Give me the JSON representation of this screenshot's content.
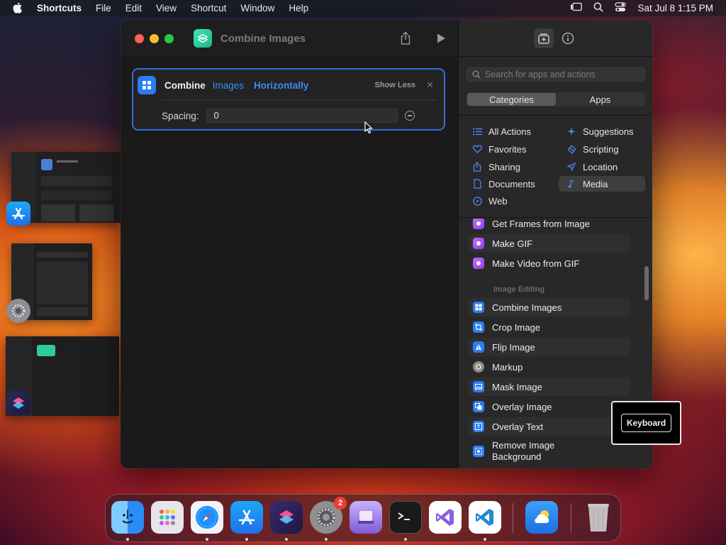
{
  "menubar": {
    "app": "Shortcuts",
    "items": [
      "File",
      "Edit",
      "View",
      "Shortcut",
      "Window",
      "Help"
    ],
    "clock": "Sat Jul 8  1:15 PM"
  },
  "window": {
    "title": "Combine Images",
    "card": {
      "verb": "Combine",
      "param1": "Images",
      "param2": "Horizontally",
      "show_less": "Show Less",
      "spacing_label": "Spacing:",
      "spacing_value": "0"
    }
  },
  "sidebar": {
    "search_placeholder": "Search for apps and actions",
    "segments": [
      "Categories",
      "Apps"
    ],
    "categories_left": [
      "All Actions",
      "Favorites",
      "Sharing",
      "Documents",
      "Web"
    ],
    "categories_right": [
      "Suggestions",
      "Scripting",
      "Location",
      "Media"
    ],
    "selected_category": "Media",
    "actions_top": [
      "Get Frames from Image",
      "Make GIF",
      "Make Video from GIF"
    ],
    "section_header": "Image Editing",
    "actions_editing": [
      "Combine Images",
      "Crop Image",
      "Flip Image",
      "Markup",
      "Mask Image",
      "Overlay Image",
      "Overlay Text",
      "Remove Image Background"
    ]
  },
  "tooltip": {
    "label": "Keyboard"
  },
  "dock": {
    "apps": [
      "Finder",
      "Launchpad",
      "Safari",
      "App Store",
      "Shortcuts",
      "System Settings",
      "Notes",
      "Terminal",
      "Visual Studio",
      "Visual Studio Code",
      "Weather",
      "Trash"
    ],
    "settings_badge": "2"
  },
  "colors": {
    "accent": "#2f6fe0",
    "link": "#3d8af7",
    "close": "#fe5f57",
    "minimize": "#febc2e",
    "zoom": "#28c840"
  }
}
